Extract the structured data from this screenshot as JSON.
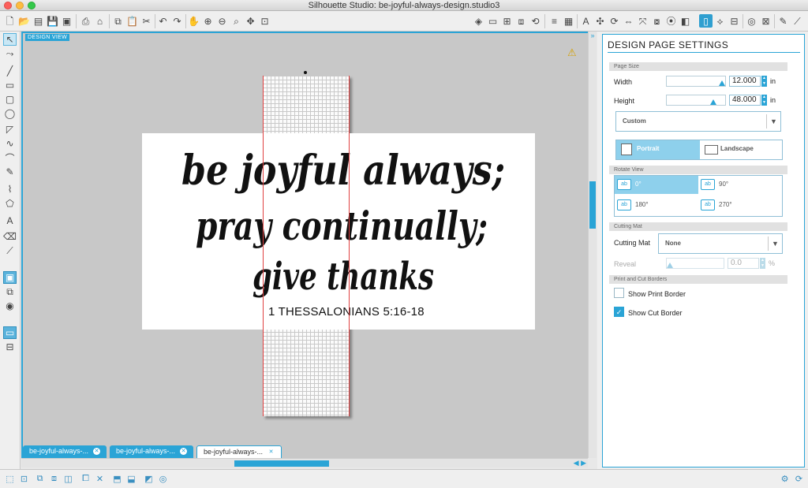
{
  "window": {
    "title": "Silhouette Studio: be-joyful-always-design.studio3"
  },
  "canvas": {
    "view_label": "DESIGN VIEW",
    "artwork": {
      "line1": "be joyful always;",
      "line2": "pray continually;",
      "line3": "give thanks",
      "reference": "1 THESSALONIANS 5:16-18"
    }
  },
  "tabs": [
    {
      "label": "be-joyful-always-..."
    },
    {
      "label": "be-joyful-always-..."
    },
    {
      "label": "be-joyful-always-..."
    }
  ],
  "panel": {
    "title": "DESIGN PAGE SETTINGS",
    "page_size": {
      "heading": "Page Size",
      "width_label": "Width",
      "width_value": "12.000",
      "width_unit": "in",
      "height_label": "Height",
      "height_value": "48.000",
      "height_unit": "in",
      "preset": "Custom",
      "portrait": "Portrait",
      "landscape": "Landscape"
    },
    "rotate_view": {
      "heading": "Rotate View",
      "r0": "0°",
      "r90": "90°",
      "r180": "180°",
      "r270": "270°",
      "icon_text": "ab"
    },
    "cutting_mat": {
      "heading": "Cutting Mat",
      "label": "Cutting Mat",
      "value": "None",
      "reveal_label": "Reveal",
      "reveal_value": "0.0",
      "reveal_unit": "%"
    },
    "borders": {
      "heading": "Print and Cut Borders",
      "show_print": "Show Print Border",
      "show_print_checked": false,
      "show_cut": "Show Cut Border",
      "show_cut_checked": true
    }
  },
  "colors": {
    "accent": "#2aa4d6",
    "canvas_bg": "#c8c8c8",
    "cut_line": "#e04040"
  }
}
